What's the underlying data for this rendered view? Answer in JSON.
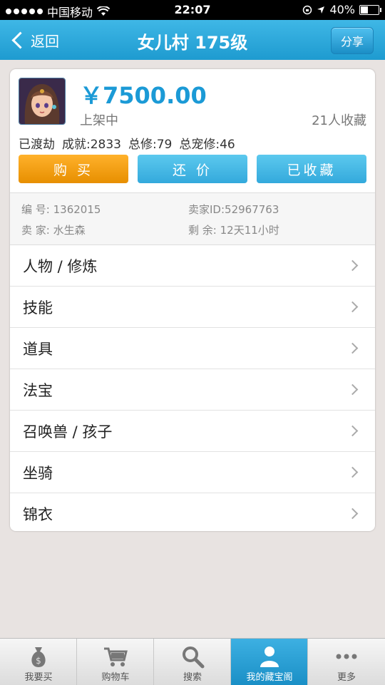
{
  "status_bar": {
    "carrier": "中国移动",
    "time": "22:07",
    "battery": "40%"
  },
  "nav": {
    "back_label": "返回",
    "title": "女儿村 175级",
    "share_label": "分享"
  },
  "item": {
    "price": "￥7500.00",
    "status": "上架中",
    "favorites": "21人收藏",
    "stats": [
      "已渡劫",
      "成就:2833",
      "总修:79",
      "总宠修:46"
    ],
    "buttons": {
      "buy": "购 买",
      "bargain": "还 价",
      "favorite": "已收藏"
    },
    "info": {
      "id_label": "编 号:",
      "id_value": "1362015",
      "seller_id_label": "卖家ID:",
      "seller_id_value": "52967763",
      "seller_label": "卖 家:",
      "seller_value": "水生森",
      "remaining_label": "剩 余:",
      "remaining_value": "12天11小时"
    }
  },
  "menu": [
    {
      "label": "人物 / 修炼"
    },
    {
      "label": "技能"
    },
    {
      "label": "道具"
    },
    {
      "label": "法宝"
    },
    {
      "label": "召唤兽 / 孩子"
    },
    {
      "label": "坐骑"
    },
    {
      "label": "锦衣"
    }
  ],
  "tabs": [
    {
      "label": "我要买",
      "icon": "money-bag-icon"
    },
    {
      "label": "购物车",
      "icon": "cart-icon"
    },
    {
      "label": "搜索",
      "icon": "search-icon"
    },
    {
      "label": "我的藏宝阁",
      "icon": "user-icon"
    },
    {
      "label": "更多",
      "icon": "more-icon"
    }
  ],
  "colors": {
    "accent": "#1e9bd0",
    "buy": "#f0a010",
    "price": "#1b9ad6"
  }
}
